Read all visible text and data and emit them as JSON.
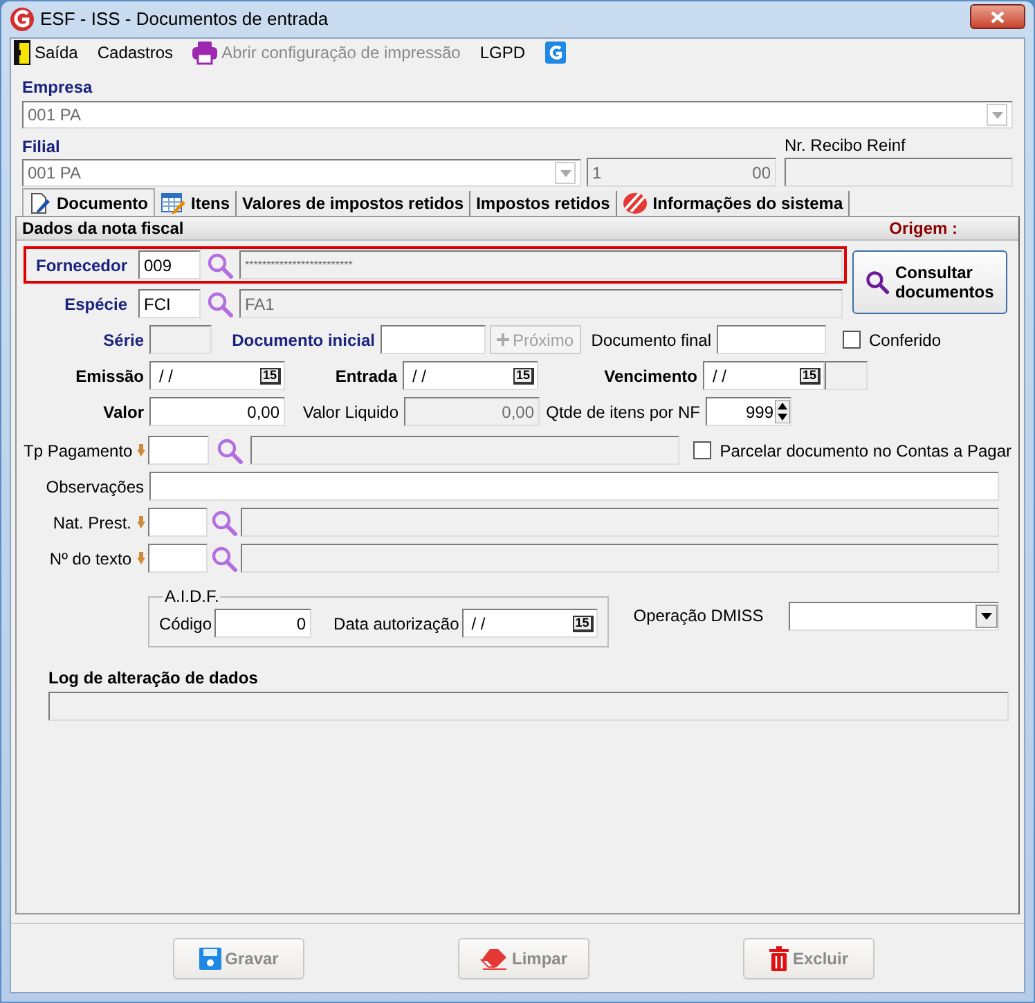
{
  "window": {
    "title": "ESF - ISS - Documentos de entrada"
  },
  "menu": [
    {
      "kind": "exit",
      "label": "Saída",
      "disabled": false
    },
    {
      "kind": "plain",
      "label": "Cadastros",
      "disabled": false
    },
    {
      "kind": "printer",
      "label": "Abrir configuração de impressão",
      "disabled": true
    },
    {
      "kind": "plain",
      "label": "LGPD",
      "disabled": false
    },
    {
      "kind": "logo"
    }
  ],
  "empresa": {
    "label": "Empresa",
    "value": "001 PA"
  },
  "filial": {
    "label": "Filial",
    "value": "001 PA",
    "document_start": "1",
    "document_end": "00"
  },
  "recibo": {
    "label": "Nr. Recibo Reinf"
  },
  "tabs": [
    {
      "kind": "document",
      "label": "Documento",
      "selected": true
    },
    {
      "kind": "table",
      "label": "Itens",
      "selected": false
    },
    {
      "kind": "plain",
      "label": "Valores de impostos retidos",
      "selected": false
    },
    {
      "kind": "plain",
      "label": "Impostos retidos",
      "selected": false
    },
    {
      "kind": "info",
      "label": "Informações do sistema",
      "selected": false
    }
  ],
  "panel": {
    "title": "Dados da nota fiscal",
    "origem": "Origem :"
  },
  "fornecedor": {
    "label": "Fornecedor",
    "code": "009",
    "description": "*************************",
    "highlighted": true
  },
  "especie": {
    "label": "Espécie",
    "code": "FCI",
    "description": "FA1"
  },
  "consultar_button": {
    "label": "Consultar documentos"
  },
  "serie": {
    "label": "Série"
  },
  "documento_inicial": {
    "label": "Documento inicial"
  },
  "proximo_button": {
    "label": "Próximo",
    "disabled": true
  },
  "documento_final": {
    "label": "Documento final"
  },
  "conferido": {
    "label": "Conferido",
    "checked": false
  },
  "emissao": {
    "label": "Emissão",
    "value": "/ /",
    "calendar": "15"
  },
  "entrada": {
    "label": "Entrada",
    "value": "/ /",
    "calendar": "15"
  },
  "vencimento": {
    "label": "Vencimento",
    "value": "/ /",
    "calendar": "15"
  },
  "valor": {
    "label": "Valor",
    "value": "0,00"
  },
  "valor_liquido": {
    "label": "Valor Liquido",
    "value": "0,00"
  },
  "qtde": {
    "label": "Qtde de itens por NF",
    "value": "999"
  },
  "tp_pagamento": {
    "label": "Tp Pagamento"
  },
  "parcelar": {
    "label": "Parcelar documento no Contas a Pagar",
    "checked": false
  },
  "observacoes": {
    "label": "Observações"
  },
  "nat_prest": {
    "label": "Nat. Prest."
  },
  "num_texto": {
    "label": "Nº do texto"
  },
  "aidf": {
    "title": "A.I.D.F.",
    "codigo_label": "Código",
    "codigo_value": "0",
    "data_label": "Data autorização",
    "data_value": "/ /",
    "data_calendar": "15"
  },
  "operacao_dmiss": {
    "label": "Operação DMISS"
  },
  "log": {
    "label": "Log de alteração de dados"
  },
  "buttons": [
    {
      "kind": "save",
      "label": "Gravar",
      "disabled": true
    },
    {
      "kind": "clear",
      "label": "Limpar",
      "disabled": true
    },
    {
      "kind": "delete",
      "label": "Excluir",
      "disabled": true
    }
  ]
}
